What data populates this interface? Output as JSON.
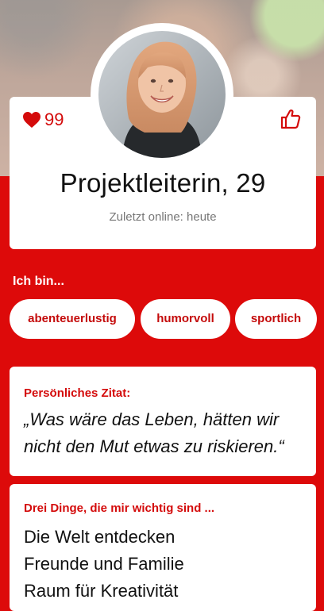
{
  "profile": {
    "likes_count": "99",
    "headline": "Projektleiterin, 29",
    "last_online": "Zuletzt online: heute"
  },
  "traits": {
    "label": "Ich bin...",
    "items": [
      "abenteuerlustig",
      "humorvoll",
      "sportlich"
    ]
  },
  "quote": {
    "title": "Persönliches Zitat:",
    "line1": "„Was wäre das Leben, hätten wir",
    "line2": "nicht den Mut etwas zu riskieren.“"
  },
  "important": {
    "title": "Drei Dinge, die mir wichtig sind ...",
    "items": [
      "Die Welt entdecken",
      "Freunde und Familie",
      "Raum für Kreativität"
    ]
  },
  "colors": {
    "brand_red": "#dd0a0a",
    "accent_red": "#d40b0b"
  },
  "icons": {
    "likes": "heart-icon",
    "like_action": "thumbs-up-icon"
  }
}
